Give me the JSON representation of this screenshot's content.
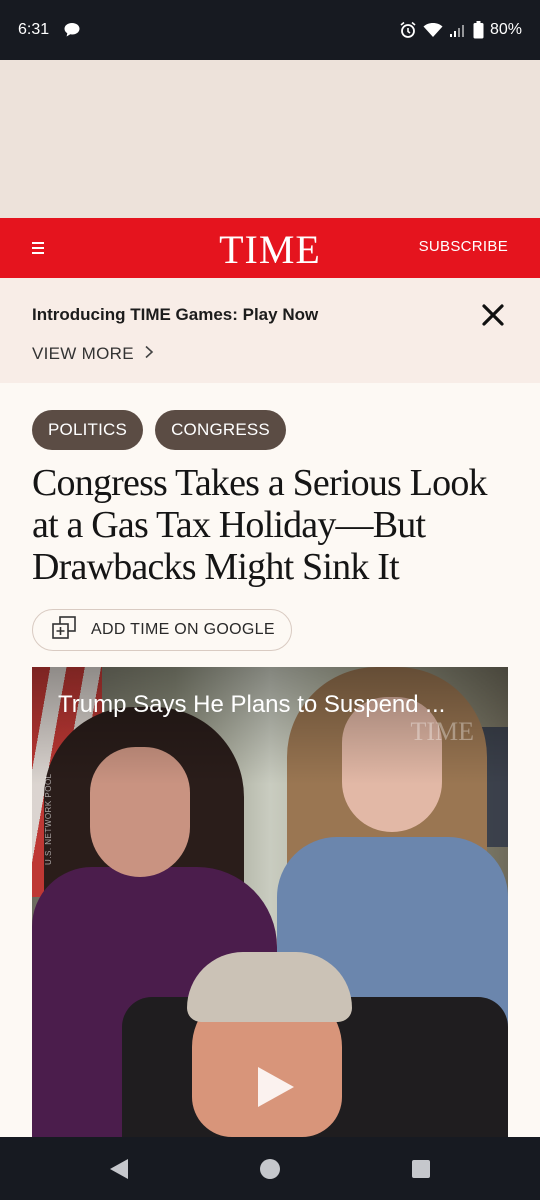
{
  "status_bar": {
    "time": "6:31",
    "battery": "80%"
  },
  "header": {
    "logo": "TIME",
    "subscribe": "SUBSCRIBE",
    "brand_color": "#e5141e"
  },
  "promo": {
    "title": "Introducing TIME Games: Play Now",
    "view_more": "VIEW MORE"
  },
  "article": {
    "tags": [
      "POLITICS",
      "CONGRESS"
    ],
    "headline": "Congress Takes a Serious Look at a Gas Tax Holiday—But Drawbacks Might Sink It",
    "google_button": "ADD TIME ON GOOGLE"
  },
  "video": {
    "title": "Trump Says He Plans to Suspend ...",
    "watermark": "TIME",
    "credit": "U.S. NETWORK POOL"
  },
  "icons": {
    "chat": "chat-bubble-icon",
    "alarm": "alarm-icon",
    "wifi": "wifi-icon",
    "signal": "signal-icon",
    "battery": "battery-icon",
    "menu": "hamburger-menu-icon",
    "close": "close-icon",
    "chevron": "chevron-right-icon",
    "add": "add-to-google-icon",
    "play": "play-icon",
    "back": "back-icon",
    "home": "home-icon",
    "recents": "recents-icon"
  }
}
